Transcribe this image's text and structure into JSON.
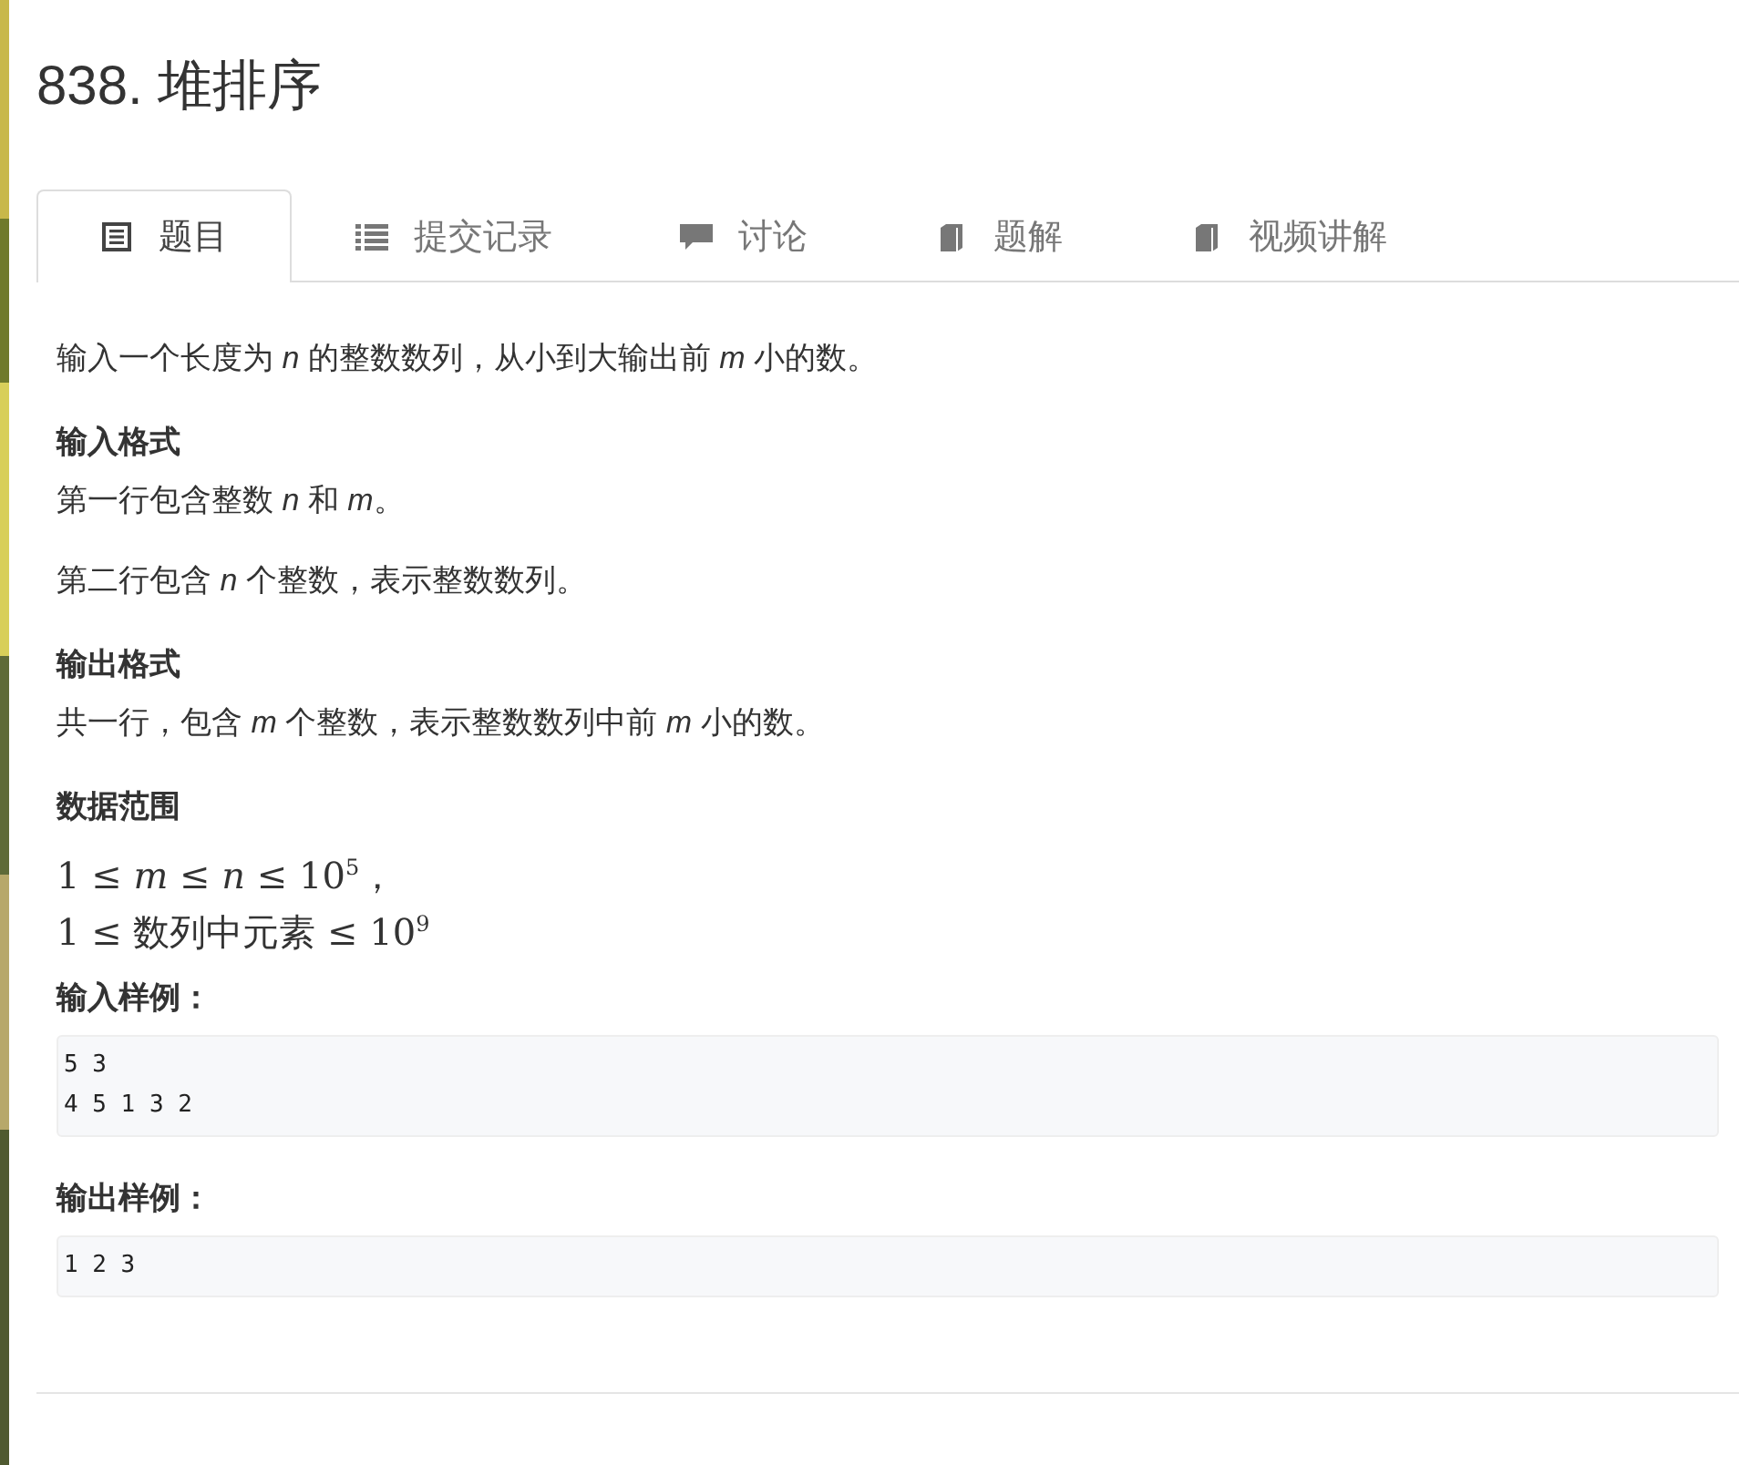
{
  "title": "838. 堆排序",
  "tabs": [
    {
      "label": "题目",
      "selected": true
    },
    {
      "label": "提交记录",
      "selected": false
    },
    {
      "label": "讨论",
      "selected": false
    },
    {
      "label": "题解",
      "selected": false
    },
    {
      "label": "视频讲解",
      "selected": false
    }
  ],
  "content": [
    {
      "kind": "paragraph",
      "text": "输入一个长度为 *n* 的整数数列，从小到大输出前 *m* 小的数。"
    },
    {
      "kind": "heading",
      "text": "输入格式"
    },
    {
      "kind": "line",
      "text": "第一行包含整数 *n* 和 *m*。"
    },
    {
      "kind": "paragraph",
      "text": "第二行包含 *n* 个整数，表示整数数列。"
    },
    {
      "kind": "heading",
      "text": "输出格式"
    },
    {
      "kind": "paragraph",
      "text": "共一行，包含 *m* 个整数，表示整数数列中前 *m* 小的数。"
    },
    {
      "kind": "heading",
      "text": "数据范围"
    },
    {
      "kind": "math",
      "text": "1 ≤ *m* ≤ *n* ≤ 10$^{5}$，"
    },
    {
      "kind": "math",
      "text": "1 ≤ 数列中元素 ≤ 10$^{9}$"
    },
    {
      "kind": "heading",
      "text": "输入样例："
    },
    {
      "kind": "code",
      "lines": [
        "5 3",
        "4 5 1 3 2"
      ]
    },
    {
      "kind": "heading",
      "text": "输出样例："
    },
    {
      "kind": "code",
      "lines": [
        "1 2 3"
      ]
    }
  ]
}
